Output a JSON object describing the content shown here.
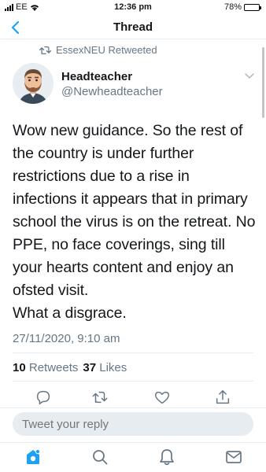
{
  "status_bar": {
    "carrier": "EE",
    "time": "12:36 pm",
    "battery": "78%",
    "battery_level": 0.78
  },
  "nav": {
    "title": "Thread"
  },
  "retweet_context": {
    "label": "EssexNEU Retweeted"
  },
  "author": {
    "name": "Headteacher",
    "handle": "@Newheadteacher"
  },
  "tweet": {
    "text": "Wow new guidance. So the rest of the country is under further restrictions due to a rise in infections it appears that in primary school the virus is on the retreat. No PPE, no face coverings, sing till your hearts content and enjoy an ofsted visit.\nWhat a disgrace.",
    "timestamp": "27/11/2020, 9:10 am"
  },
  "stats": {
    "retweets_count": "10",
    "retweets_label": "Retweets",
    "likes_count": "37",
    "likes_label": "Likes"
  },
  "reply": {
    "placeholder": "Tweet your reply"
  },
  "colors": {
    "accent": "#1da1f2",
    "secondary_text": "#657786",
    "divider": "#e6ecf0"
  },
  "icons": [
    "back-arrow-icon",
    "retweet-icon",
    "caret-down-icon",
    "reply-icon",
    "like-icon",
    "share-icon",
    "home-icon",
    "search-icon",
    "notifications-icon",
    "messages-icon"
  ]
}
